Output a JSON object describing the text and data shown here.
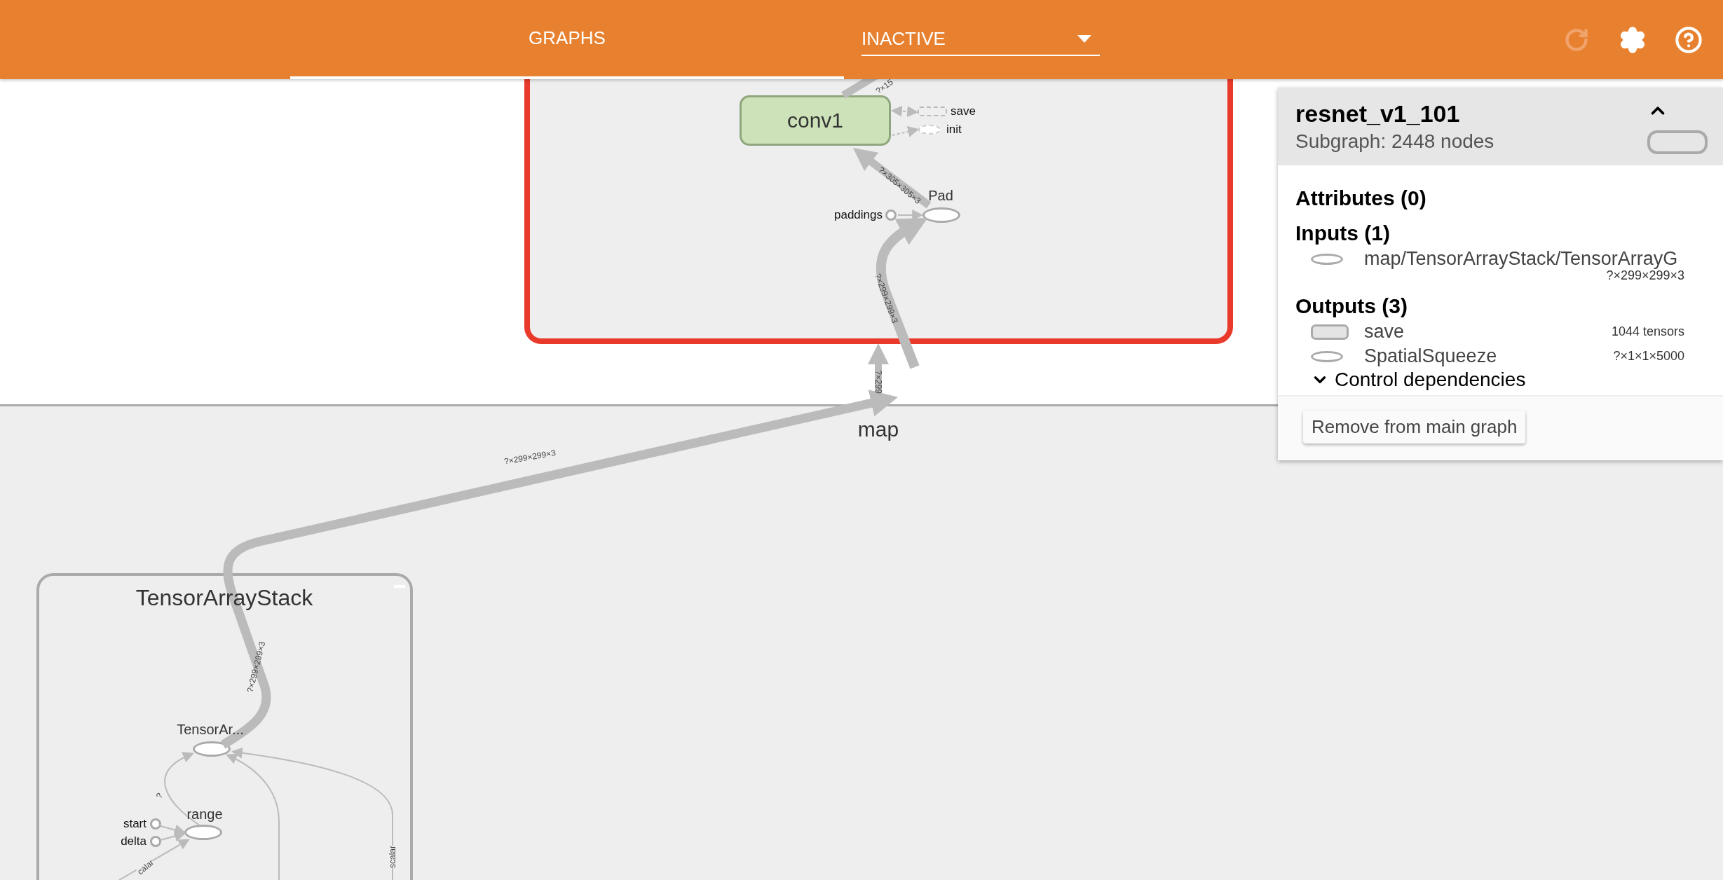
{
  "header": {
    "tabs": [
      {
        "label": "GRAPHS",
        "selected": true
      }
    ],
    "run_select": {
      "value": "INACTIVE"
    },
    "toolbar": [
      {
        "kind": "reload",
        "disabled": true
      },
      {
        "kind": "settings",
        "disabled": false
      },
      {
        "kind": "help",
        "disabled": false
      }
    ]
  },
  "graph": {
    "scopes": [
      {
        "kind": "outer",
        "label": "map"
      },
      {
        "kind": "highlight",
        "selected": true
      },
      {
        "kind": "group",
        "label": "TensorArrayStack",
        "expanded": true
      }
    ],
    "nodes": [
      {
        "kind": "meta",
        "label": "conv1"
      },
      {
        "kind": "aux-rect",
        "label": "save"
      },
      {
        "kind": "aux-ellipse",
        "label": "init"
      },
      {
        "kind": "op",
        "label": "Pad"
      },
      {
        "kind": "const",
        "label": "paddings"
      },
      {
        "kind": "op",
        "label": "TensorAr..."
      },
      {
        "kind": "op",
        "label": "range"
      },
      {
        "kind": "const",
        "label": "start"
      },
      {
        "kind": "const",
        "label": "delta"
      }
    ],
    "edge_labels": [
      "?×15",
      "?×305×305×3",
      "?×299×299×3",
      "?×299",
      "?×299×299×3",
      "?×299×299×3",
      "?",
      "scalar",
      "calar"
    ]
  },
  "info_panel": {
    "title": "resnet_v1_101",
    "subtitle": "Subgraph: 2448 nodes",
    "expanded": true,
    "attributes_heading": "Attributes (0)",
    "inputs_heading": "Inputs (1)",
    "inputs": [
      {
        "kind": "op",
        "name": "map/TensorArrayStack/TensorArrayG",
        "detail": "?×299×299×3"
      }
    ],
    "outputs_heading": "Outputs (3)",
    "outputs": [
      {
        "kind": "meta",
        "name": "save",
        "detail": "1044 tensors"
      },
      {
        "kind": "op",
        "name": "SpatialSqueeze",
        "detail": "?×1×1×5000"
      }
    ],
    "control_dependencies": {
      "label": "Control dependencies",
      "expanded": false
    },
    "button": "Remove from main graph"
  }
}
